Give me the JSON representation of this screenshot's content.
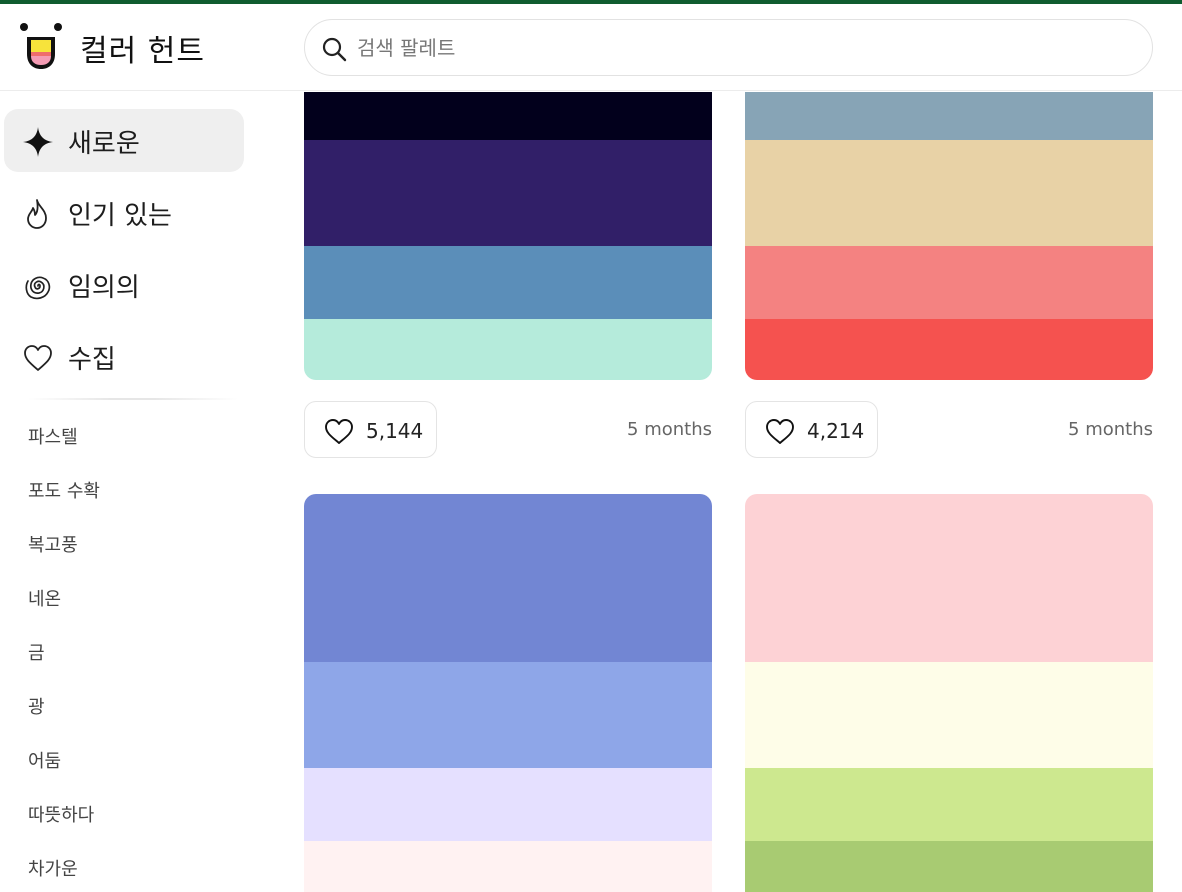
{
  "app": {
    "brand": "컬러 헌트"
  },
  "search": {
    "placeholder": "검색 팔레트"
  },
  "nav": [
    {
      "label": "새로운",
      "icon": "sparkle-icon",
      "active": true
    },
    {
      "label": "인기 있는",
      "icon": "flame-icon",
      "active": false
    },
    {
      "label": "임의의",
      "icon": "spiral-icon",
      "active": false
    },
    {
      "label": "수집",
      "icon": "heart-icon",
      "active": false
    }
  ],
  "tags": [
    "파스텔",
    "포도 수확",
    "복고풍",
    "네온",
    "금",
    "광",
    "어둠",
    "따뜻하다",
    "차가운"
  ],
  "palettes": [
    {
      "colors": [
        "#02001c",
        "#311f68",
        "#5b8eb9",
        "#b5ebdb"
      ],
      "likes": "5,144",
      "time": "5 months"
    },
    {
      "colors": [
        "#87a4b6",
        "#e8d2a6",
        "#f48281",
        "#f5524f"
      ],
      "likes": "4,214",
      "time": "5 months"
    },
    {
      "colors": [
        "#7286d3",
        "#8ea6e8",
        "#e5e0ff",
        "#fff2f2"
      ]
    },
    {
      "colors": [
        "#fdd2d5",
        "#fefde8",
        "#cde88f",
        "#a8cb72"
      ]
    }
  ],
  "colors": {
    "accent_bar": "#0f5c2f",
    "active_nav_bg": "#efefef"
  }
}
